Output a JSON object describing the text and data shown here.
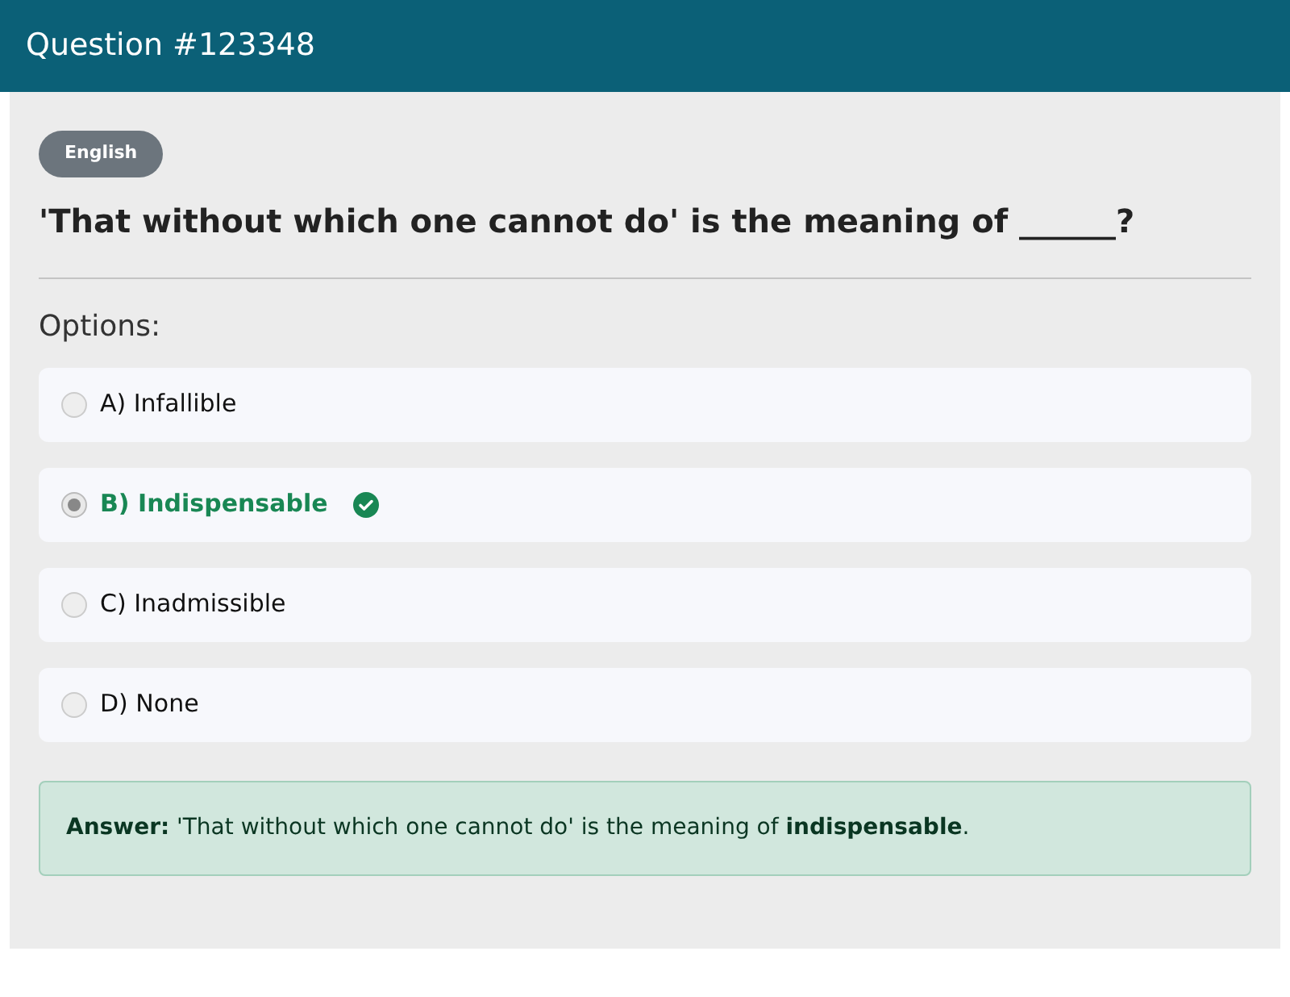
{
  "header": {
    "title": "Question #123348"
  },
  "badge": "English",
  "question": "'That without which one cannot do' is the meaning of ______?",
  "options_label": "Options:",
  "options": [
    {
      "label": "A) Infallible",
      "selected": false,
      "correct": false
    },
    {
      "label": "B) Indispensable",
      "selected": true,
      "correct": true
    },
    {
      "label": "C) Inadmissible",
      "selected": false,
      "correct": false
    },
    {
      "label": "D) None",
      "selected": false,
      "correct": false
    }
  ],
  "answer": "**Answer:** 'That without which one cannot do' is the meaning of **indispensable**."
}
